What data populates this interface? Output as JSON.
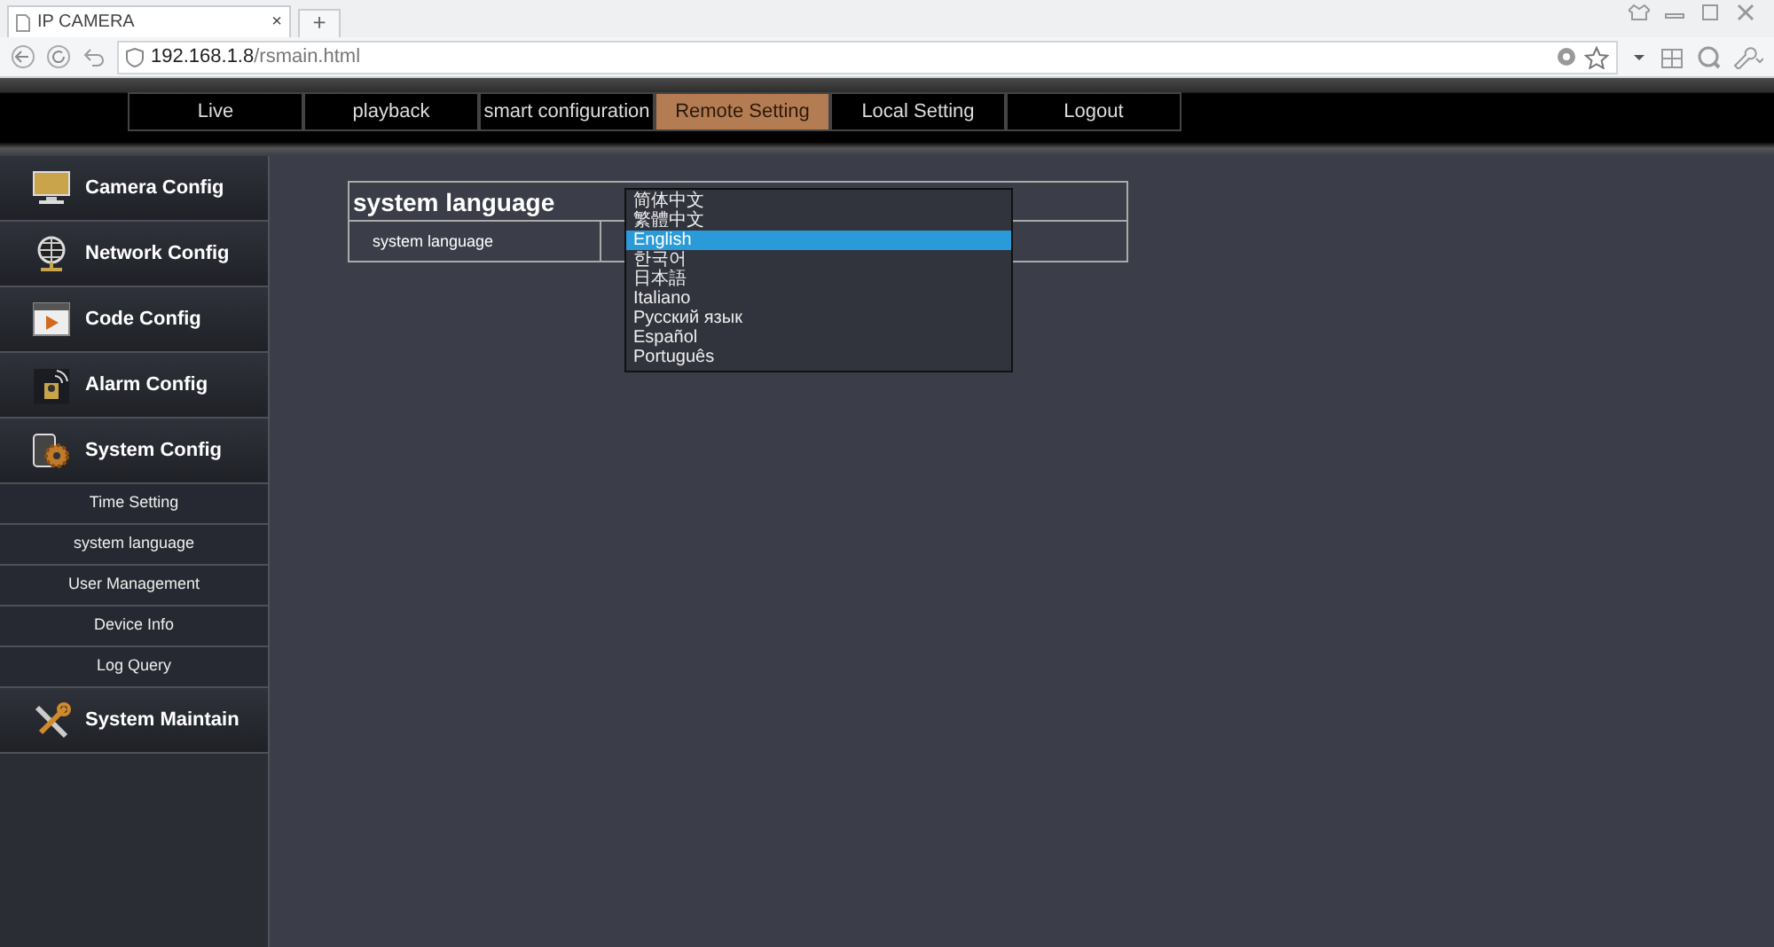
{
  "browser": {
    "tab_title": "IP CAMERA",
    "tab_close": "×",
    "new_tab": "+",
    "address_host": "192.168.1.8",
    "address_path": "/rsmain.html"
  },
  "nav": [
    {
      "label": "Live",
      "selected": false
    },
    {
      "label": "playback",
      "selected": false
    },
    {
      "label": "smart configuration",
      "selected": false
    },
    {
      "label": "Remote Setting",
      "selected": true
    },
    {
      "label": "Local Setting",
      "selected": false
    },
    {
      "label": "Logout",
      "selected": false
    }
  ],
  "sidebar": {
    "items": [
      {
        "label": "Camera Config",
        "kind": "monitor"
      },
      {
        "label": "Network Config",
        "kind": "globe"
      },
      {
        "label": "Code Config",
        "kind": "video"
      },
      {
        "label": "Alarm Config",
        "kind": "alarm"
      },
      {
        "label": "System Config",
        "kind": "gear",
        "children": [
          {
            "label": "Time Setting"
          },
          {
            "label": "system language"
          },
          {
            "label": "User Management"
          },
          {
            "label": "Device Info"
          },
          {
            "label": "Log Query"
          }
        ]
      },
      {
        "label": "System Maintain",
        "kind": "tools"
      }
    ]
  },
  "panel": {
    "title": "system language",
    "rows": [
      {
        "label": "system language"
      }
    ],
    "dropdown": {
      "options": [
        {
          "label": "简体中文",
          "selected": false
        },
        {
          "label": "繁體中文",
          "selected": false
        },
        {
          "label": "English",
          "selected": true
        },
        {
          "label": "한국어",
          "selected": false
        },
        {
          "label": "日本語",
          "selected": false
        },
        {
          "label": "Italiano",
          "selected": false
        },
        {
          "label": "Русский язык",
          "selected": false
        },
        {
          "label": "Español",
          "selected": false
        },
        {
          "label": "Português",
          "selected": false
        }
      ]
    }
  }
}
